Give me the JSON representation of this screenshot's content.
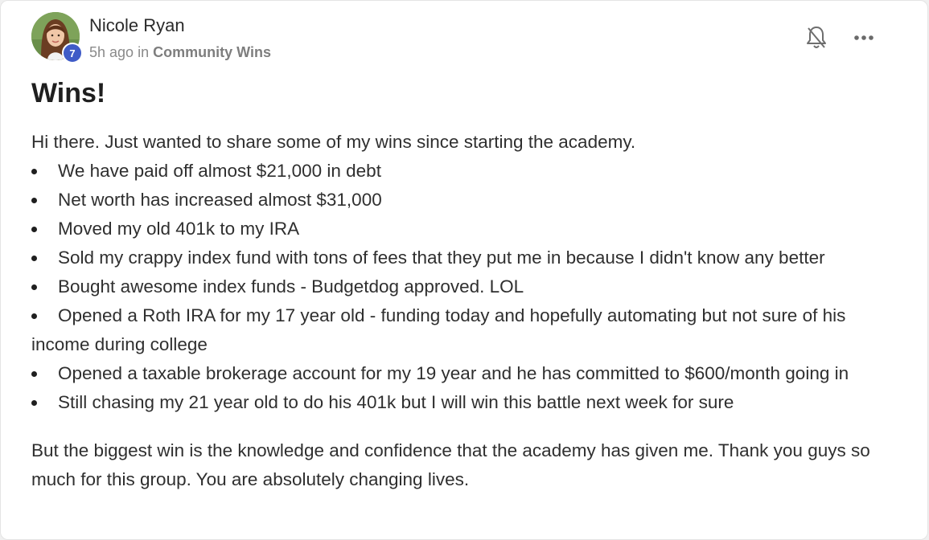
{
  "post": {
    "author": {
      "name": "Nicole Ryan",
      "level": "7"
    },
    "meta": {
      "time": "5h ago",
      "in_word": "in",
      "category": "Community Wins"
    },
    "title": "Wins!",
    "intro": "Hi there. Just wanted to share some of my wins since starting the academy.",
    "bullets": [
      "We have paid off almost $21,000 in debt",
      "Net worth has increased almost $31,000",
      "Moved my old 401k to my IRA",
      "Sold my crappy index fund with tons of fees that they put me in because I didn't know any better",
      "Bought awesome index funds - Budgetdog approved. LOL",
      "Opened a Roth IRA for my 17 year old - funding today and hopefully automating but not sure of his income during college",
      "Opened a taxable brokerage account for my 19 year and he has committed to $600/month going in",
      "Still chasing my 21 year old to do his 401k but I will win this battle next week for sure"
    ],
    "closing": "But the biggest win is the knowledge and confidence that the academy has given me. Thank you guys so much for this group. You are absolutely changing lives."
  },
  "icons": {
    "notification": "bell-off-icon",
    "more": "more-horizontal-icon"
  },
  "colors": {
    "level_badge": "#3f5bc7",
    "text": "#2f2f2f",
    "meta": "#8a8a8a"
  }
}
